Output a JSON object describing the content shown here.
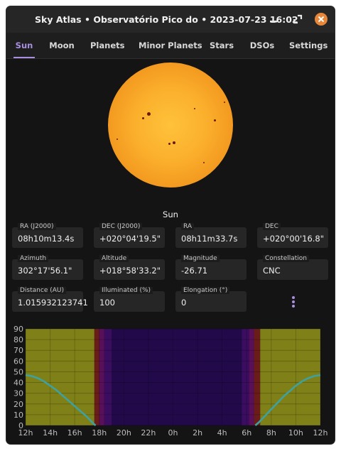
{
  "window": {
    "title": "Sky Atlas  •  Observatório Pico do  •  2023-07-23 16:02"
  },
  "tabs": [
    {
      "label": "Sun",
      "active": true
    },
    {
      "label": "Moon",
      "active": false
    },
    {
      "label": "Planets",
      "active": false
    },
    {
      "label": "Minor Planets",
      "active": false
    },
    {
      "label": "Stars",
      "active": false
    },
    {
      "label": "DSOs",
      "active": false
    },
    {
      "label": "Settings",
      "active": false
    }
  ],
  "object": {
    "name": "Sun"
  },
  "fields": {
    "ra_j2000": {
      "label": "RA (J2000)",
      "value": "08h10m13.4s"
    },
    "dec_j2000": {
      "label": "DEC (J2000)",
      "value": "+020°04'19.5\""
    },
    "ra": {
      "label": "RA",
      "value": "08h11m33.7s"
    },
    "dec": {
      "label": "DEC",
      "value": "+020°00'16.8\""
    },
    "azimuth": {
      "label": "Azimuth",
      "value": "302°17'56.1\""
    },
    "altitude": {
      "label": "Altitude",
      "value": "+018°58'33.2\""
    },
    "magnitude": {
      "label": "Magnitude",
      "value": "-26.71"
    },
    "constellation": {
      "label": "Constellation",
      "value": "CNC"
    },
    "distance": {
      "label": "Distance (AU)",
      "value": "1.015932123741"
    },
    "illuminated": {
      "label": "Illuminated (%)",
      "value": "100"
    },
    "elongation": {
      "label": "Elongation (°)",
      "value": "0"
    }
  },
  "icons": {
    "minimize": "minimize-icon",
    "maximize": "maximize-icon",
    "close": "close-icon",
    "more": "more-vertical-icon"
  },
  "colors": {
    "accent": "#a98fe0",
    "close_button": "#e8873a",
    "day": "#808018",
    "civil_twilight": "#6a1c18",
    "nautical_twilight": "#5a1058",
    "astronomical_twilight": "#3a0d60",
    "night": "#220a4a",
    "altitude_curve": "#3fa0a0"
  },
  "chart_data": {
    "type": "line",
    "title": "",
    "xlabel": "",
    "ylabel": "",
    "x_ticks": [
      "12h",
      "14h",
      "16h",
      "18h",
      "20h",
      "22h",
      "0h",
      "2h",
      "4h",
      "6h",
      "8h",
      "10h",
      "12h"
    ],
    "y_ticks": [
      "0",
      "10",
      "20",
      "30",
      "40",
      "50",
      "60",
      "70",
      "80",
      "90"
    ],
    "xlim": [
      0,
      24
    ],
    "ylim": [
      0,
      90
    ],
    "grid": true,
    "bands": [
      {
        "from": 0,
        "to": 5.6,
        "kind": "day"
      },
      {
        "from": 5.6,
        "to": 6.0,
        "kind": "civil_twilight"
      },
      {
        "from": 6.0,
        "to": 6.4,
        "kind": "nautical_twilight"
      },
      {
        "from": 6.4,
        "to": 7.0,
        "kind": "astronomical_twilight"
      },
      {
        "from": 7.0,
        "to": 17.6,
        "kind": "night"
      },
      {
        "from": 17.6,
        "to": 18.2,
        "kind": "astronomical_twilight"
      },
      {
        "from": 18.2,
        "to": 18.6,
        "kind": "nautical_twilight"
      },
      {
        "from": 18.6,
        "to": 19.1,
        "kind": "civil_twilight"
      },
      {
        "from": 19.1,
        "to": 24,
        "kind": "day"
      }
    ],
    "series": [
      {
        "x": [
          0,
          0.5,
          1,
          1.5,
          2,
          2.5,
          3,
          3.5,
          4,
          4.5,
          5,
          5.5,
          5.7
        ],
        "y": [
          47,
          46,
          44,
          41,
          37,
          33,
          28,
          23,
          18,
          13,
          8,
          2,
          0
        ]
      },
      {
        "x": [
          18.7,
          19,
          19.5,
          20,
          20.5,
          21,
          21.5,
          22,
          22.5,
          23,
          23.5,
          24
        ],
        "y": [
          0,
          3,
          9,
          15,
          21,
          27,
          32,
          37,
          41,
          44,
          46,
          47
        ]
      }
    ]
  }
}
